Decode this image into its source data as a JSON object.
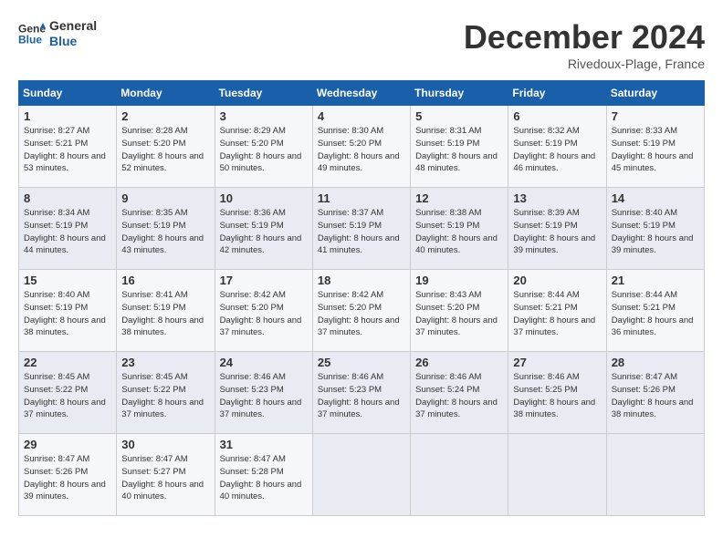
{
  "logo": {
    "line1": "General",
    "line2": "Blue"
  },
  "title": "December 2024",
  "subtitle": "Rivedoux-Plage, France",
  "weekdays": [
    "Sunday",
    "Monday",
    "Tuesday",
    "Wednesday",
    "Thursday",
    "Friday",
    "Saturday"
  ],
  "weeks": [
    [
      {
        "day": "1",
        "sunrise": "8:27 AM",
        "sunset": "5:21 PM",
        "daylight": "8 hours and 53 minutes."
      },
      {
        "day": "2",
        "sunrise": "8:28 AM",
        "sunset": "5:20 PM",
        "daylight": "8 hours and 52 minutes."
      },
      {
        "day": "3",
        "sunrise": "8:29 AM",
        "sunset": "5:20 PM",
        "daylight": "8 hours and 50 minutes."
      },
      {
        "day": "4",
        "sunrise": "8:30 AM",
        "sunset": "5:20 PM",
        "daylight": "8 hours and 49 minutes."
      },
      {
        "day": "5",
        "sunrise": "8:31 AM",
        "sunset": "5:19 PM",
        "daylight": "8 hours and 48 minutes."
      },
      {
        "day": "6",
        "sunrise": "8:32 AM",
        "sunset": "5:19 PM",
        "daylight": "8 hours and 46 minutes."
      },
      {
        "day": "7",
        "sunrise": "8:33 AM",
        "sunset": "5:19 PM",
        "daylight": "8 hours and 45 minutes."
      }
    ],
    [
      {
        "day": "8",
        "sunrise": "8:34 AM",
        "sunset": "5:19 PM",
        "daylight": "8 hours and 44 minutes."
      },
      {
        "day": "9",
        "sunrise": "8:35 AM",
        "sunset": "5:19 PM",
        "daylight": "8 hours and 43 minutes."
      },
      {
        "day": "10",
        "sunrise": "8:36 AM",
        "sunset": "5:19 PM",
        "daylight": "8 hours and 42 minutes."
      },
      {
        "day": "11",
        "sunrise": "8:37 AM",
        "sunset": "5:19 PM",
        "daylight": "8 hours and 41 minutes."
      },
      {
        "day": "12",
        "sunrise": "8:38 AM",
        "sunset": "5:19 PM",
        "daylight": "8 hours and 40 minutes."
      },
      {
        "day": "13",
        "sunrise": "8:39 AM",
        "sunset": "5:19 PM",
        "daylight": "8 hours and 39 minutes."
      },
      {
        "day": "14",
        "sunrise": "8:40 AM",
        "sunset": "5:19 PM",
        "daylight": "8 hours and 39 minutes."
      }
    ],
    [
      {
        "day": "15",
        "sunrise": "8:40 AM",
        "sunset": "5:19 PM",
        "daylight": "8 hours and 38 minutes."
      },
      {
        "day": "16",
        "sunrise": "8:41 AM",
        "sunset": "5:19 PM",
        "daylight": "8 hours and 38 minutes."
      },
      {
        "day": "17",
        "sunrise": "8:42 AM",
        "sunset": "5:20 PM",
        "daylight": "8 hours and 37 minutes."
      },
      {
        "day": "18",
        "sunrise": "8:42 AM",
        "sunset": "5:20 PM",
        "daylight": "8 hours and 37 minutes."
      },
      {
        "day": "19",
        "sunrise": "8:43 AM",
        "sunset": "5:20 PM",
        "daylight": "8 hours and 37 minutes."
      },
      {
        "day": "20",
        "sunrise": "8:44 AM",
        "sunset": "5:21 PM",
        "daylight": "8 hours and 37 minutes."
      },
      {
        "day": "21",
        "sunrise": "8:44 AM",
        "sunset": "5:21 PM",
        "daylight": "8 hours and 36 minutes."
      }
    ],
    [
      {
        "day": "22",
        "sunrise": "8:45 AM",
        "sunset": "5:22 PM",
        "daylight": "8 hours and 37 minutes."
      },
      {
        "day": "23",
        "sunrise": "8:45 AM",
        "sunset": "5:22 PM",
        "daylight": "8 hours and 37 minutes."
      },
      {
        "day": "24",
        "sunrise": "8:46 AM",
        "sunset": "5:23 PM",
        "daylight": "8 hours and 37 minutes."
      },
      {
        "day": "25",
        "sunrise": "8:46 AM",
        "sunset": "5:23 PM",
        "daylight": "8 hours and 37 minutes."
      },
      {
        "day": "26",
        "sunrise": "8:46 AM",
        "sunset": "5:24 PM",
        "daylight": "8 hours and 37 minutes."
      },
      {
        "day": "27",
        "sunrise": "8:46 AM",
        "sunset": "5:25 PM",
        "daylight": "8 hours and 38 minutes."
      },
      {
        "day": "28",
        "sunrise": "8:47 AM",
        "sunset": "5:26 PM",
        "daylight": "8 hours and 38 minutes."
      }
    ],
    [
      {
        "day": "29",
        "sunrise": "8:47 AM",
        "sunset": "5:26 PM",
        "daylight": "8 hours and 39 minutes."
      },
      {
        "day": "30",
        "sunrise": "8:47 AM",
        "sunset": "5:27 PM",
        "daylight": "8 hours and 40 minutes."
      },
      {
        "day": "31",
        "sunrise": "8:47 AM",
        "sunset": "5:28 PM",
        "daylight": "8 hours and 40 minutes."
      },
      null,
      null,
      null,
      null
    ]
  ]
}
